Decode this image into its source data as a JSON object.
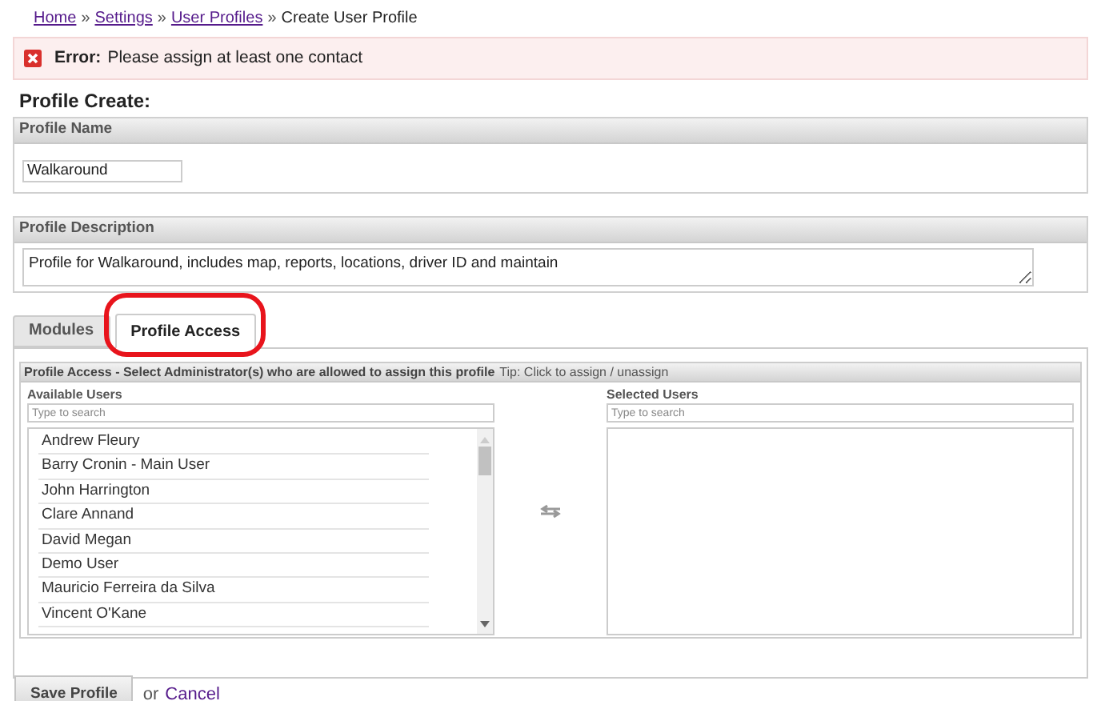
{
  "breadcrumb": {
    "links": [
      "Home",
      "Settings",
      "User Profiles"
    ],
    "separator": "»",
    "current": "Create User Profile"
  },
  "error": {
    "label": "Error:",
    "message": "Please assign at least one contact"
  },
  "heading": "Profile Create:",
  "profile_name": {
    "label": "Profile Name",
    "value": "Walkaround"
  },
  "profile_description": {
    "label": "Profile Description",
    "value": "Profile for Walkaround, includes map, reports, locations, driver ID and maintain"
  },
  "tabs": [
    {
      "label": "Modules",
      "selected": false
    },
    {
      "label": "Profile Access",
      "selected": true,
      "circled": true
    }
  ],
  "access_panel": {
    "title": "Profile Access - Select Administrator(s) who are allowed to assign this profile",
    "tip": "Tip: Click to assign / unassign",
    "available": {
      "label": "Available Users",
      "placeholder": "Type to search",
      "users": [
        "Andrew Fleury",
        "Barry Cronin - Main User",
        "John Harrington",
        "Clare Annand",
        "David Megan",
        "Demo User",
        "Mauricio Ferreira da Silva",
        "Vincent O'Kane"
      ]
    },
    "selected": {
      "label": "Selected Users",
      "placeholder": "Type to search"
    }
  },
  "save_button": "Save Profile",
  "or_text": "or",
  "cancel_link": "Cancel"
}
